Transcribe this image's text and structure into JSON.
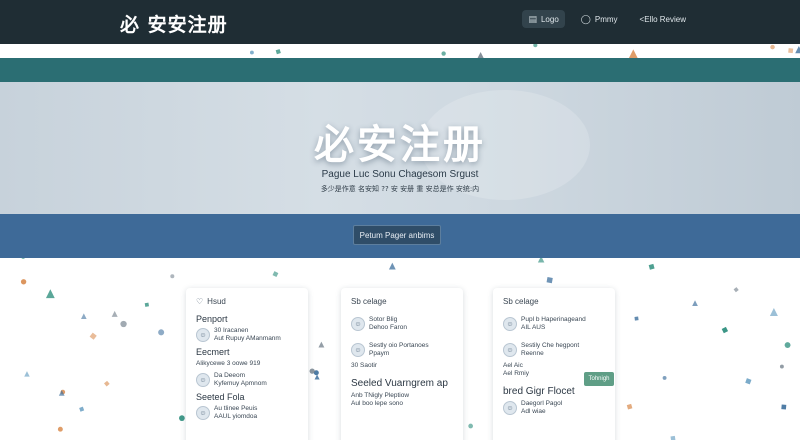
{
  "colors": {
    "nav_bg": "#1f2d34",
    "teal_band": "#2b6e73",
    "blue_band": "#3e6a98",
    "button_bg": "#2f4d68",
    "accent_green": "#5f9e86",
    "confetti": [
      "#3d6f9c",
      "#2f8f7e",
      "#d98c4f",
      "#6c7a86",
      "#4f8fb8"
    ]
  },
  "nav": {
    "brand": "必 安安注册",
    "links": [
      {
        "label": "Logo",
        "icon": "clipboard-icon",
        "active": true
      },
      {
        "label": "Pmmy",
        "icon": "shield-icon",
        "active": false
      },
      {
        "label": "<Ello Review",
        "icon": "",
        "active": false
      }
    ]
  },
  "hero": {
    "title": "必安注册",
    "subtitle": "Pague Luc Sonu Chagesom Srgust",
    "subtitle2": "多少是作意 名安知 ?? 安 安册 重 安总是作 安统:内",
    "button": "Petum Pager anbims"
  },
  "cards": [
    {
      "header": "Hsud",
      "header_icon": "heart-icon",
      "sections": [
        {
          "title": "Penport",
          "rows": [
            {
              "line1": "30 Iracanen",
              "line2": "Aut Rupuy AManmanm"
            }
          ]
        },
        {
          "title": "Eecmert",
          "rows": [
            {
              "line1": "Alikycewe 3 oowe 919",
              "line2": ""
            },
            {
              "line1": "Da Deeom",
              "line2": "Kyfemuy Apmnom"
            }
          ]
        },
        {
          "title": "Seeted Fola",
          "rows": [
            {
              "line1": "Au tlinee Peuis",
              "line2": "AAUL yiomdoa"
            }
          ]
        }
      ]
    },
    {
      "header": "Sb celage",
      "header_icon": "",
      "sections": [
        {
          "title": "",
          "rows": [
            {
              "line1": "Sotor Blig",
              "line2": "Dehoo Faron"
            }
          ]
        },
        {
          "title": "",
          "rows": [
            {
              "line1": "Sestly oio Portanoes",
              "line2": "Ppaym"
            },
            {
              "line1": "30 Saotir",
              "line2": ""
            }
          ]
        },
        {
          "title": "Seeled Vuarngrem ap",
          "big": true,
          "rows": [
            {
              "line1": "Anb TNigly Pleptiow",
              "line2": "Aul boo lepe sono"
            }
          ]
        }
      ]
    },
    {
      "header": "Sb celage",
      "header_icon": "",
      "chip": "Tohnigh",
      "sections": [
        {
          "title": "",
          "rows": [
            {
              "line1": "Pupl b Haperinageand",
              "line2": "AIL AUS"
            }
          ]
        },
        {
          "title": "",
          "rows": [
            {
              "line1": "Sestily Che hegpont",
              "line2": "Reenne"
            },
            {
              "line1": "Ael Aic",
              "line2": "Ael Rmiy"
            }
          ]
        },
        {
          "title": "bred Gigr Flocet",
          "big": true,
          "rows": [
            {
              "line1": "Daegorl Pagol",
              "line2": "Adl wiae"
            }
          ]
        }
      ]
    }
  ]
}
